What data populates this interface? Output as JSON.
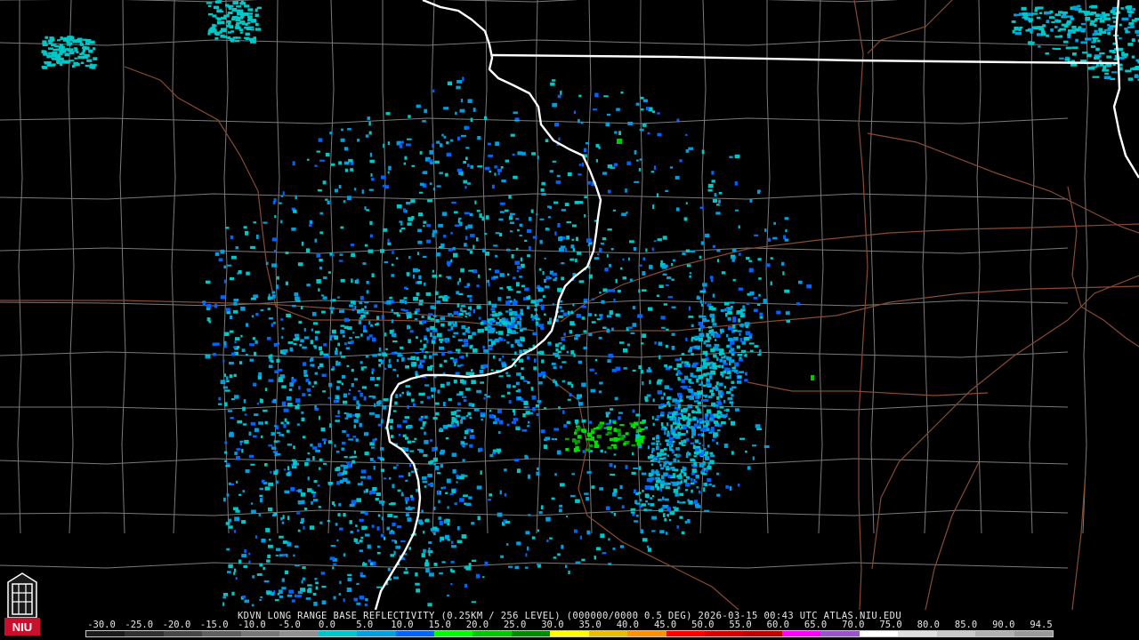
{
  "caption": "KDVN LONG RANGE BASE REFLECTIVITY (0.25KM / 256 LEVEL) (000000/0000 0.5 DEG) 2026-03-15 00:43 UTC  ATLAS.NIU.EDU",
  "logo": {
    "icon": "niu-logo-icon",
    "text": "NIU",
    "colors": {
      "red": "#c8102e",
      "white": "#ffffff"
    }
  },
  "colors": {
    "background": "#000000",
    "state_boundary": "#ffffff",
    "county_boundary": "#7a7a7a",
    "highway": "#8a4a33"
  },
  "scale": {
    "labels": [
      "-30.0",
      "-25.0",
      "-20.0",
      "-15.0",
      "-10.0",
      "-5.0",
      "0.0",
      "5.0",
      "10.0",
      "15.0",
      "20.0",
      "25.0",
      "30.0",
      "35.0",
      "40.0",
      "45.0",
      "50.0",
      "55.0",
      "60.0",
      "65.0",
      "70.0",
      "75.0",
      "80.0",
      "85.0",
      "90.0",
      "94.5"
    ],
    "colors": [
      "#1a1a1a",
      "#303030",
      "#484848",
      "#606060",
      "#787878",
      "#909090",
      "#00c8c8",
      "#00a0e0",
      "#0064ff",
      "#00ff00",
      "#00c800",
      "#008c00",
      "#ffff00",
      "#e6c000",
      "#ff9000",
      "#ff0000",
      "#d60000",
      "#c00000",
      "#ff00ff",
      "#9955c9",
      "#ffffff",
      "#e0e0e0",
      "#c8c8c8",
      "#b0b0b0",
      "#9a9a9a"
    ]
  }
}
